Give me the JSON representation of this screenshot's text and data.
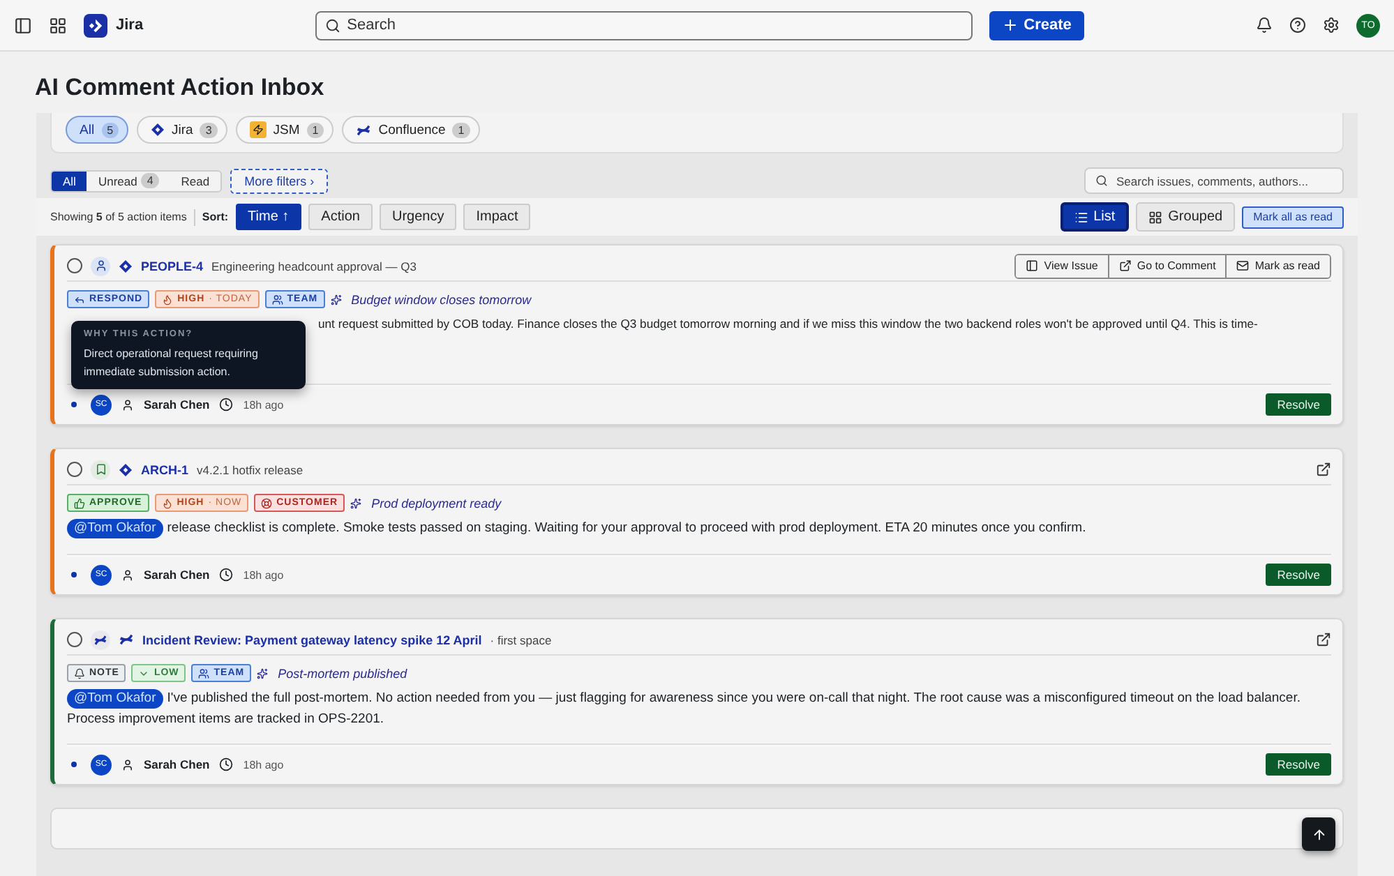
{
  "topbar": {
    "product": "Jira",
    "search_placeholder": "Search",
    "create_label": "Create",
    "avatar_initials": "TO"
  },
  "page_title": "AI Comment Action Inbox",
  "sources": [
    {
      "kind": "all",
      "label": "All",
      "count": "5",
      "selected": true
    },
    {
      "kind": "jira",
      "label": "Jira",
      "count": "3",
      "selected": false
    },
    {
      "kind": "jsm",
      "label": "JSM",
      "count": "1",
      "selected": false
    },
    {
      "kind": "confluence",
      "label": "Confluence",
      "count": "1",
      "selected": false
    }
  ],
  "read_filters": [
    {
      "label": "All",
      "selected": true
    },
    {
      "label": "Unread",
      "count": "4",
      "selected": false
    },
    {
      "label": "Read",
      "selected": false
    }
  ],
  "more_filters": "More filters ›",
  "search_placeholder": "Search issues, comments, authors...",
  "summary": "Showing **5** of 5 action items",
  "sort_label": "Sort:",
  "sort_options": [
    {
      "label": "Time ↑",
      "selected": true
    },
    {
      "label": "Action",
      "selected": false
    },
    {
      "label": "Urgency",
      "selected": false
    },
    {
      "label": "Impact",
      "selected": false
    }
  ],
  "views": [
    {
      "kind": "list",
      "label": "List",
      "selected": true
    },
    {
      "kind": "grouped",
      "label": "Grouped",
      "selected": false
    }
  ],
  "mark_all": "Mark all as read",
  "items": [
    {
      "color": "#e8731a",
      "checked": false,
      "kind": "person",
      "key": "PEOPLE-4",
      "title": "Engineering headcount approval — Q3",
      "actions": [
        {
          "kind": "view",
          "label": "View Issue"
        },
        {
          "kind": "goto",
          "label": "Go to Comment"
        },
        {
          "kind": "read",
          "label": "Mark as read"
        }
      ],
      "tags": [
        {
          "kind": "respond",
          "label": "RESPOND"
        },
        {
          "kind": "high",
          "label": "HIGH",
          "sub": "· TODAY"
        },
        {
          "kind": "team",
          "label": "TEAM"
        }
      ],
      "ai_hint": "Budget window closes tomorrow",
      "body": "unt request submitted by COB today. Finance closes the Q3 budget tomorrow morning and if we miss this window the two backend roles won't be approved until Q4. This is time-",
      "tooltip": {
        "heading": "WHY THIS ACTION?",
        "text": "Direct operational request requiring immediate submission action."
      },
      "unread": true,
      "avatar": "SC",
      "author": "Sarah Chen",
      "time": "18h ago",
      "resolve": "Resolve"
    },
    {
      "color": "#e8731a",
      "checked": false,
      "kind": "bookmark",
      "key": "ARCH-1",
      "title": "v4.2.1 hotfix release",
      "tags": [
        {
          "kind": "approve",
          "label": "APPROVE"
        },
        {
          "kind": "high",
          "label": "HIGH",
          "sub": "· NOW"
        },
        {
          "kind": "customer",
          "label": "CUSTOMER"
        }
      ],
      "ai_hint": "Prod deployment ready",
      "mention": "@Tom Okafor",
      "body": "release checklist is complete. Smoke tests passed on staging. Waiting for your approval to proceed with prod deployment. ETA 20 minutes once you confirm.",
      "unread": true,
      "avatar": "SC",
      "author": "Sarah Chen",
      "time": "18h ago",
      "resolve": "Resolve"
    },
    {
      "color": "#1f6b3a",
      "checked": false,
      "kind": "confluence",
      "key": "Incident Review: Payment gateway latency spike 12 April",
      "space": "· first space",
      "tags": [
        {
          "kind": "note",
          "label": "NOTE"
        },
        {
          "kind": "low",
          "label": "LOW"
        },
        {
          "kind": "team",
          "label": "TEAM"
        }
      ],
      "ai_hint": "Post-mortem published",
      "mention": "@Tom Okafor",
      "body": "I've published the full post-mortem. No action needed from you — just flagging for awareness since you were on-call that night. The root cause was a misconfigured timeout on the load balancer. Process improvement items are tracked in OPS-2201.",
      "unread": true,
      "avatar": "SC",
      "author": "Sarah Chen",
      "time": "18h ago",
      "resolve": "Resolve"
    }
  ]
}
